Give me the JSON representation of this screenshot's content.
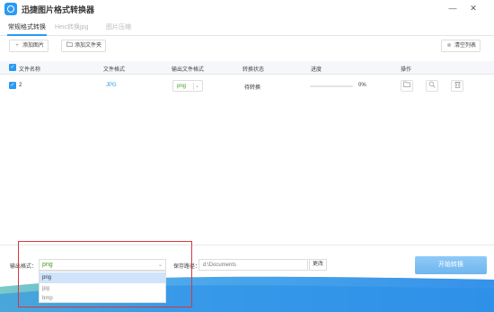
{
  "window": {
    "title": "迅捷图片格式转换器",
    "minimize_glyph": "—",
    "close_glyph": "✕"
  },
  "tabs": [
    {
      "label": "常规格式转换",
      "active": true
    },
    {
      "label": "Heic转换jpg",
      "active": false
    },
    {
      "label": "图片压缩",
      "active": false
    }
  ],
  "toolbar": {
    "add_image_label": "添加图片",
    "add_folder_label": "添加文件夹",
    "clear_list_label": "清空列表"
  },
  "table": {
    "columns": [
      "文件名称",
      "文件格式",
      "输出文件格式",
      "转换状态",
      "进度",
      "操作"
    ],
    "rows": [
      {
        "name": "2",
        "format": "JPG",
        "output_format": "png",
        "status": "待转换",
        "progress_text": "0%",
        "progress": 0,
        "checked": true
      }
    ]
  },
  "bottom": {
    "output_format_label": "输出格式：",
    "output_format_value": "png",
    "output_format_options": [
      "png",
      "jpg",
      "bmp"
    ],
    "save_path_label": "保存路径：",
    "save_path_value": "d:\\Documents",
    "change_label": "更改",
    "start_label": "开始转换"
  },
  "icons": {
    "folder": "folder-icon",
    "search": "search-icon",
    "trash": "trash-icon"
  },
  "colors": {
    "accent": "#2b9af3",
    "format_text": "#3a9d23",
    "highlight": "#d9363e",
    "start_button": "#7fbff4"
  }
}
